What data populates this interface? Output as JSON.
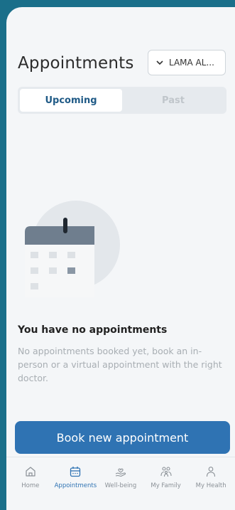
{
  "header": {
    "title": "Appointments",
    "member_selector": "LAMA AL..."
  },
  "tabs": [
    {
      "label": "Upcoming",
      "active": true
    },
    {
      "label": "Past",
      "active": false
    }
  ],
  "empty_state": {
    "title": "You have no appointments",
    "description": "No appointments booked yet, book an in-person or a virtual appointment with the right doctor."
  },
  "actions": {
    "book_label": "Book new appointment"
  },
  "nav": [
    {
      "label": "Home",
      "icon": "home-icon",
      "active": false
    },
    {
      "label": "Appointments",
      "icon": "calendar-icon",
      "active": true
    },
    {
      "label": "Well-being",
      "icon": "hand-heart-icon",
      "active": false
    },
    {
      "label": "My Family",
      "icon": "family-icon",
      "active": false
    },
    {
      "label": "My Health",
      "icon": "person-icon",
      "active": false
    }
  ],
  "colors": {
    "accent": "#2f73b3",
    "tab_active_text": "#1f5a86",
    "background": "#f4f6f8",
    "frame": "#1a6f8a"
  }
}
